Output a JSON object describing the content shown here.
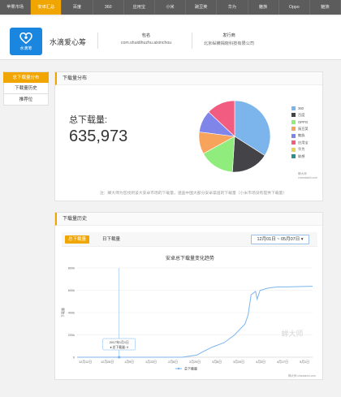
{
  "nav": {
    "tabs": [
      "苹果市场",
      "安卓汇总",
      "百度",
      "360",
      "应用宝",
      "小米",
      "豌豆荚",
      "华为",
      "魅族",
      "Oppo",
      "魅族"
    ],
    "active_index": 1
  },
  "app": {
    "logo_text": "水滴筹",
    "name": "水滴爱心筹",
    "package_label": "包名",
    "package_value": "com.shuidihuzhu.aixinchou",
    "developer_label": "发行商",
    "developer_value": "北京纵横揭晓科技有限公司"
  },
  "sidebar": {
    "items": [
      "总下载量分布",
      "下载量历史",
      "推荐位"
    ],
    "active_index": 0
  },
  "distribution": {
    "title": "下载量分布",
    "total_label": "总下载量:",
    "total_value": "635,973",
    "credit": "蝉大师 chandashi.com",
    "note": "注：蝉大师为您找到该大安卓市场的下载量，涵盖中国大部分安卓渠道的下载量（小米市场没有提供下载量）"
  },
  "pie_chart": {
    "type": "pie",
    "slices": [
      {
        "label": "360",
        "value": 34,
        "color": "#7cb5ec"
      },
      {
        "label": "百度",
        "value": 17,
        "color": "#434348"
      },
      {
        "label": "OPPO",
        "value": 16,
        "color": "#90ed7d"
      },
      {
        "label": "豌豆荚",
        "value": 10,
        "color": "#f7a35c"
      },
      {
        "label": "魅族",
        "value": 10,
        "color": "#8085e9"
      },
      {
        "label": "应用宝",
        "value": 13,
        "color": "#f15c80"
      },
      {
        "label": "华为",
        "value": 0,
        "color": "#e4d354"
      },
      {
        "label": "联想",
        "value": 0,
        "color": "#2b908f"
      }
    ]
  },
  "history": {
    "title": "下载量历史",
    "tab_total": "总下载量",
    "tab_daily": "日下载量",
    "date_range": "12月01日 ~ 05月07日",
    "tooltip_line1": "2017年1月1日",
    "tooltip_line2": "● 总下载量: 0",
    "watermark": "蝉大师",
    "credit": "蝉大师 chandashi.com"
  },
  "chart_data": {
    "type": "line",
    "title": "安卓总下载量变化趋势",
    "series_name": "总下载量",
    "ylabel": "下载量",
    "ylim": [
      0,
      800000
    ],
    "yticks": [
      "800k",
      "600k",
      "400k",
      "200k",
      "0"
    ],
    "xticks": [
      "12月12日",
      "12月26日",
      "1月9日",
      "1月23日",
      "2月6日",
      "2月20日",
      "3月6日",
      "3月20日",
      "4月3日",
      "4月17日",
      "5月1日"
    ],
    "x": [
      0,
      6,
      14,
      20,
      28,
      42,
      56,
      70,
      80,
      84,
      90,
      98,
      105,
      112,
      114,
      116,
      118,
      119,
      120,
      122,
      124,
      126,
      128,
      130,
      134,
      140,
      148,
      157
    ],
    "values": [
      0,
      0,
      0,
      0,
      0,
      0,
      0,
      0,
      20000,
      50000,
      90000,
      130000,
      200000,
      300000,
      380000,
      560000,
      580000,
      590000,
      520000,
      600000,
      605000,
      615000,
      620000,
      625000,
      630000,
      630000,
      633000,
      635973
    ]
  }
}
